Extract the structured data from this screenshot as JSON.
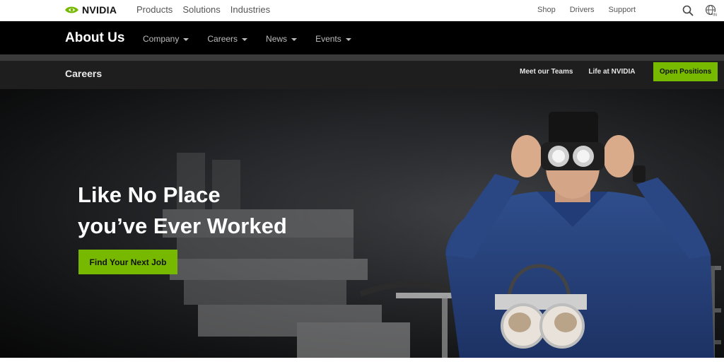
{
  "topnav": {
    "brand": "NVIDIA",
    "links": [
      "Products",
      "Solutions",
      "Industries"
    ],
    "right_links": [
      "Shop",
      "Drivers",
      "Support"
    ],
    "icons": {
      "search": "search-icon",
      "language": "globe-icon"
    }
  },
  "about": {
    "title": "About Us",
    "nav": [
      "Company",
      "Careers",
      "News",
      "Events"
    ]
  },
  "careers": {
    "title": "Careers",
    "links": [
      "Meet our Teams",
      "Life at NVIDIA"
    ],
    "cta": "Open Positions"
  },
  "hero": {
    "headline_line1": "Like No Place",
    "headline_line2": "you’ve Ever Worked",
    "button": "Find Your Next Job"
  },
  "colors": {
    "brand_green": "#76b900",
    "nav_black": "#000000",
    "sub_bar": "#1e1e1e"
  }
}
